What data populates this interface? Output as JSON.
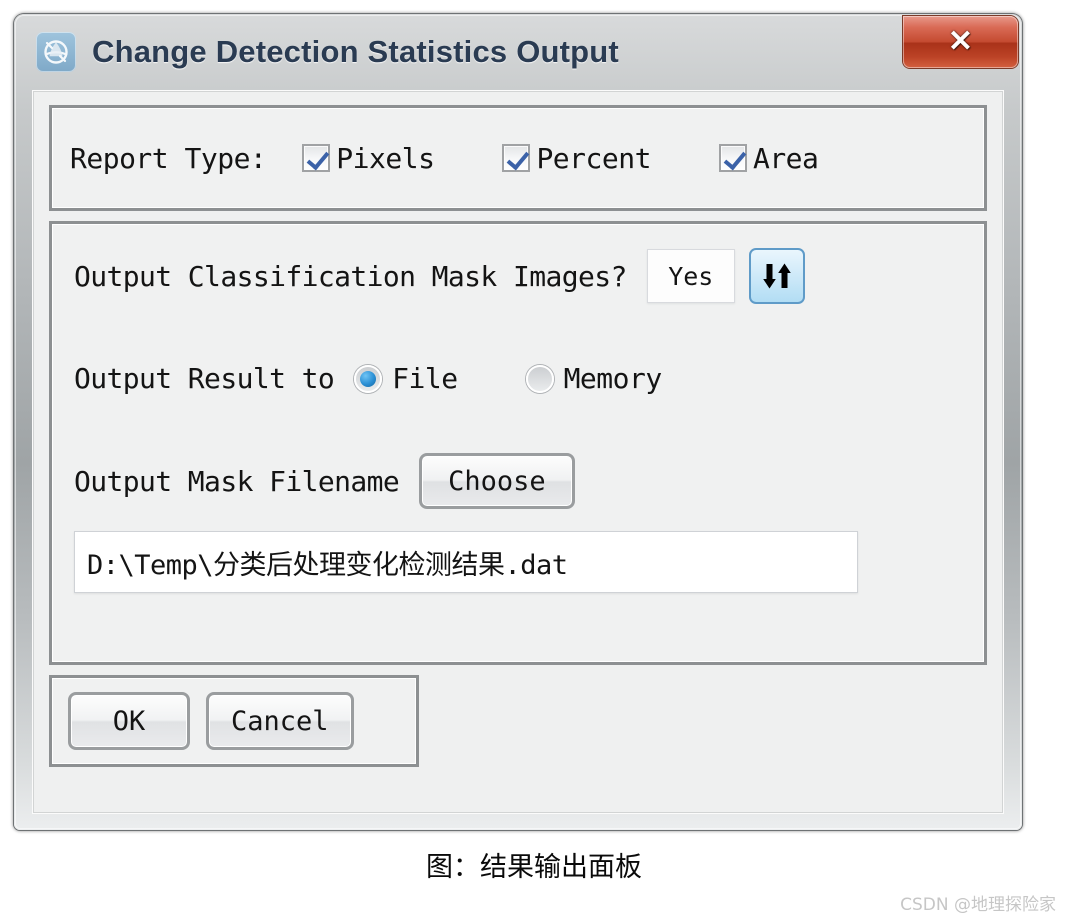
{
  "window": {
    "title": "Change Detection Statistics Output",
    "app_icon": "globe-icon",
    "close_glyph": "✕"
  },
  "report_type": {
    "label": "Report Type:",
    "options": [
      {
        "label": "Pixels",
        "checked": true
      },
      {
        "label": "Percent",
        "checked": true
      },
      {
        "label": "Area",
        "checked": true
      }
    ]
  },
  "output_options": {
    "mask_images": {
      "label": "Output Classification Mask Images?",
      "value": "Yes",
      "toggle_icon": "up-down-arrows-icon"
    },
    "output_result": {
      "label": "Output Result to",
      "options": [
        {
          "label": "File",
          "selected": true
        },
        {
          "label": "Memory",
          "selected": false
        }
      ]
    },
    "mask_filename": {
      "label": "Output Mask Filename",
      "choose_label": "Choose",
      "value": "D:\\Temp\\分类后处理变化检测结果.dat",
      "placeholder": ""
    }
  },
  "buttons": {
    "ok_label": "OK",
    "cancel_label": "Cancel"
  },
  "caption": "图：结果输出面板",
  "watermark": "CSDN @地理探险家",
  "colors": {
    "accent_blue": "#3b62a8",
    "radio_blue": "#2a8fd4",
    "close_red": "#c44a30",
    "panel_bg": "#f0f1f1",
    "toggle_border": "#5f9bc8"
  }
}
